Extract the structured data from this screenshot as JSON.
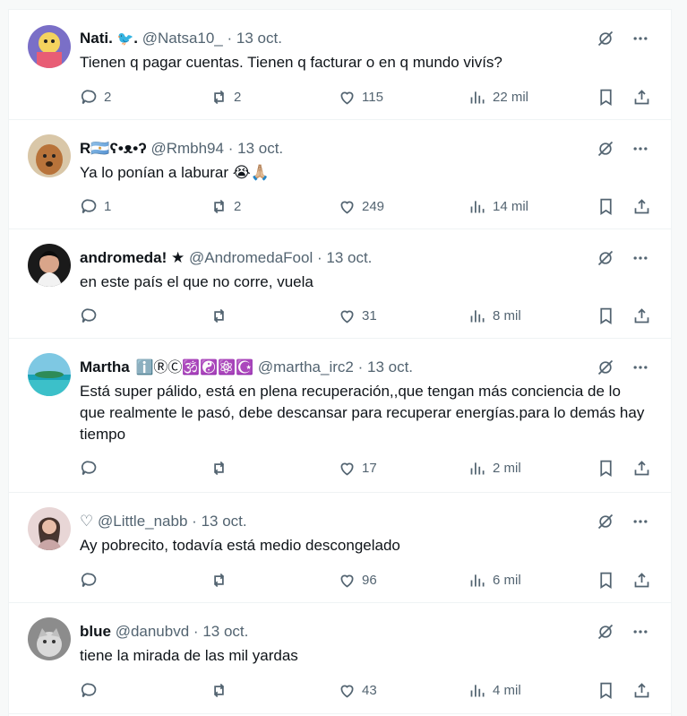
{
  "tweets": [
    {
      "name": "Nati.",
      "name_emoji": "🐦",
      "name_suffix": ".",
      "handle": "@Natsa10_",
      "date": "13 oct.",
      "text": "Tienen q pagar cuentas. Tienen q facturar o en q mundo vivís?",
      "replies": "2",
      "retweets": "2",
      "likes": "115",
      "views": "22 mil"
    },
    {
      "name": "R🇦🇷ʕ•ᴥ•ʔ",
      "handle": "@Rmbh94",
      "date": "13 oct.",
      "text": "Ya lo ponían a laburar 😭🙏🏼",
      "replies": "1",
      "retweets": "2",
      "likes": "249",
      "views": "14 mil"
    },
    {
      "name": "andromeda! ★",
      "handle": "@AndromedaFool",
      "date": "13 oct.",
      "text": "en este país el que no corre, vuela",
      "replies": "",
      "retweets": "",
      "likes": "31",
      "views": "8 mil"
    },
    {
      "name": "Martha",
      "badges": "ℹ️ⓇⒸ🕉️☯️⚛️☪️",
      "handle": "@martha_irc2",
      "date": "13 oct.",
      "text": "Está super pálido, está en plena recuperación,,que tengan más conciencia de lo que realmente le pasó, debe descansar para recuperar energías.para lo demás hay tiempo",
      "replies": "",
      "retweets": "",
      "likes": "17",
      "views": "2 mil"
    },
    {
      "name": "♡",
      "handle": "@Little_nabb",
      "date": "13 oct.",
      "text": "Ay pobrecito, todavía está medio descongelado",
      "replies": "",
      "retweets": "",
      "likes": "96",
      "views": "6 mil"
    },
    {
      "name": "blue",
      "handle": "@danubvd",
      "date": "13 oct.",
      "text": "tiene la mirada de las mil yardas",
      "replies": "",
      "retweets": "",
      "likes": "43",
      "views": "4 mil"
    }
  ],
  "colors": {
    "text": "#0f1419",
    "secondary": "#536471",
    "border": "#eff3f4"
  },
  "icons": [
    "grok-icon",
    "more-icon",
    "reply-icon",
    "retweet-icon",
    "like-icon",
    "views-icon",
    "bookmark-icon",
    "share-icon"
  ]
}
